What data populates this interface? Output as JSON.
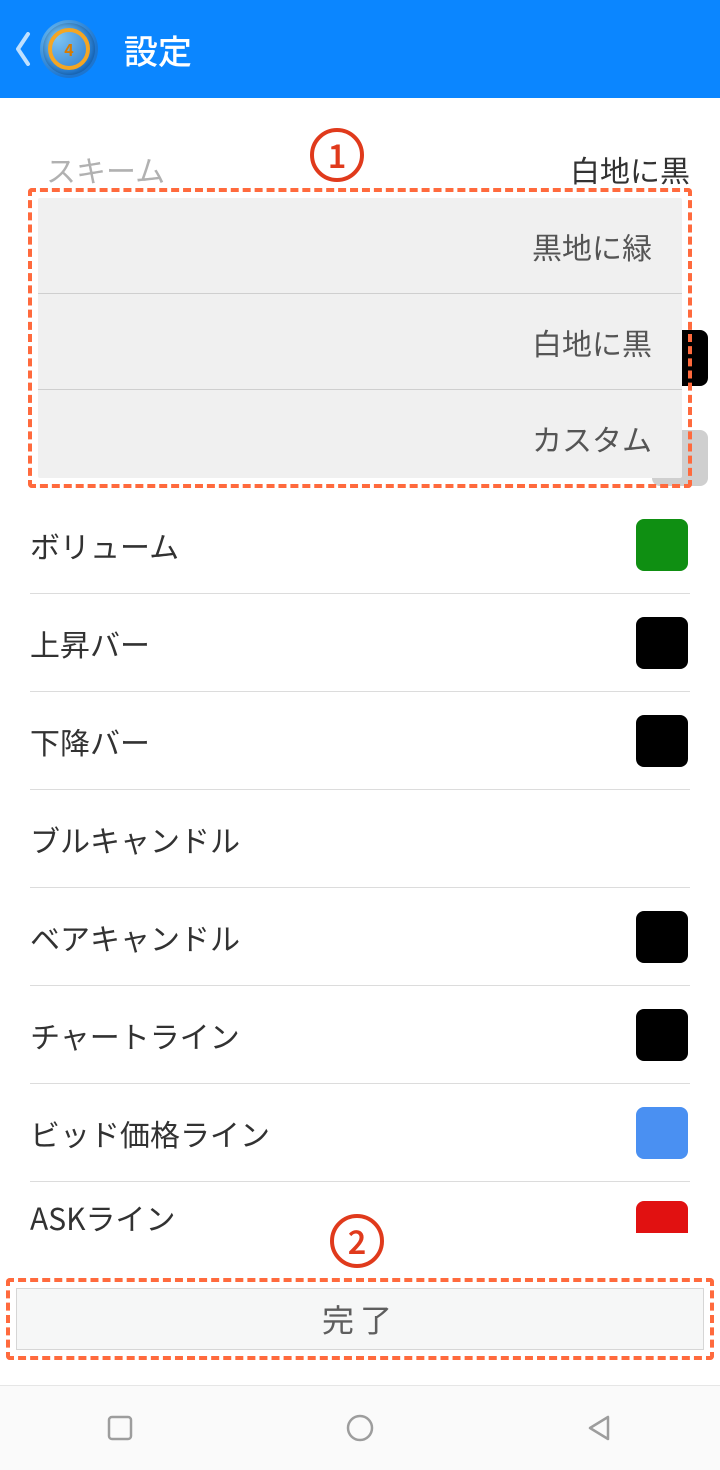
{
  "header": {
    "title": "設定"
  },
  "scheme": {
    "label": "スキーム",
    "value": "白地に黒",
    "options": [
      "黒地に緑",
      "白地に黒",
      "カスタム"
    ]
  },
  "settings": [
    {
      "label": "ボリューム",
      "color": "#0f8f12"
    },
    {
      "label": "上昇バー",
      "color": "#000000"
    },
    {
      "label": "下降バー",
      "color": "#000000"
    },
    {
      "label": "ブルキャンドル",
      "color": null
    },
    {
      "label": "ベアキャンドル",
      "color": "#000000"
    },
    {
      "label": "チャートライン",
      "color": "#000000"
    },
    {
      "label": "ビッド価格ライン",
      "color": "#4a90f2"
    },
    {
      "label": "ASKライン",
      "color": "#e11111"
    }
  ],
  "doneButton": "完了",
  "callouts": {
    "one": "1",
    "two": "2"
  }
}
